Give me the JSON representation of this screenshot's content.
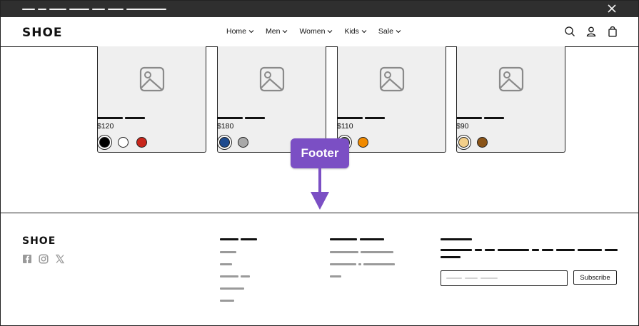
{
  "brand": {
    "logo": "SHOE"
  },
  "nav": {
    "items": [
      {
        "label": "Home"
      },
      {
        "label": "Men"
      },
      {
        "label": "Women"
      },
      {
        "label": "Kids"
      },
      {
        "label": "Sale"
      }
    ]
  },
  "header_icons": [
    "search-icon",
    "account-icon",
    "cart-bag-icon"
  ],
  "products": [
    {
      "price": "$120",
      "swatches": [
        "#000000",
        "#ffffff",
        "#c8261b"
      ],
      "selected_swatch": 0
    },
    {
      "price": "$180",
      "swatches": [
        "#1f4b8e",
        "#a9a9a9"
      ],
      "selected_swatch": 0
    },
    {
      "price": "$110",
      "swatches": [
        "#4d7a1f",
        "#f08a00"
      ],
      "selected_swatch": 0
    },
    {
      "price": "$90",
      "swatches": [
        "#f3cf8a",
        "#8a5418"
      ],
      "selected_swatch": 0
    }
  ],
  "annotation": {
    "label": "Footer",
    "color": "#7b4fc4"
  },
  "footer": {
    "logo": "SHOE",
    "social_icons": [
      "facebook-icon",
      "instagram-icon",
      "x-icon"
    ],
    "subscribe_label": "Subscribe"
  },
  "colors": {
    "accent": "#7b4fc4",
    "announcement_bg": "#2f2f2f",
    "thumb_bg": "#efefef"
  }
}
